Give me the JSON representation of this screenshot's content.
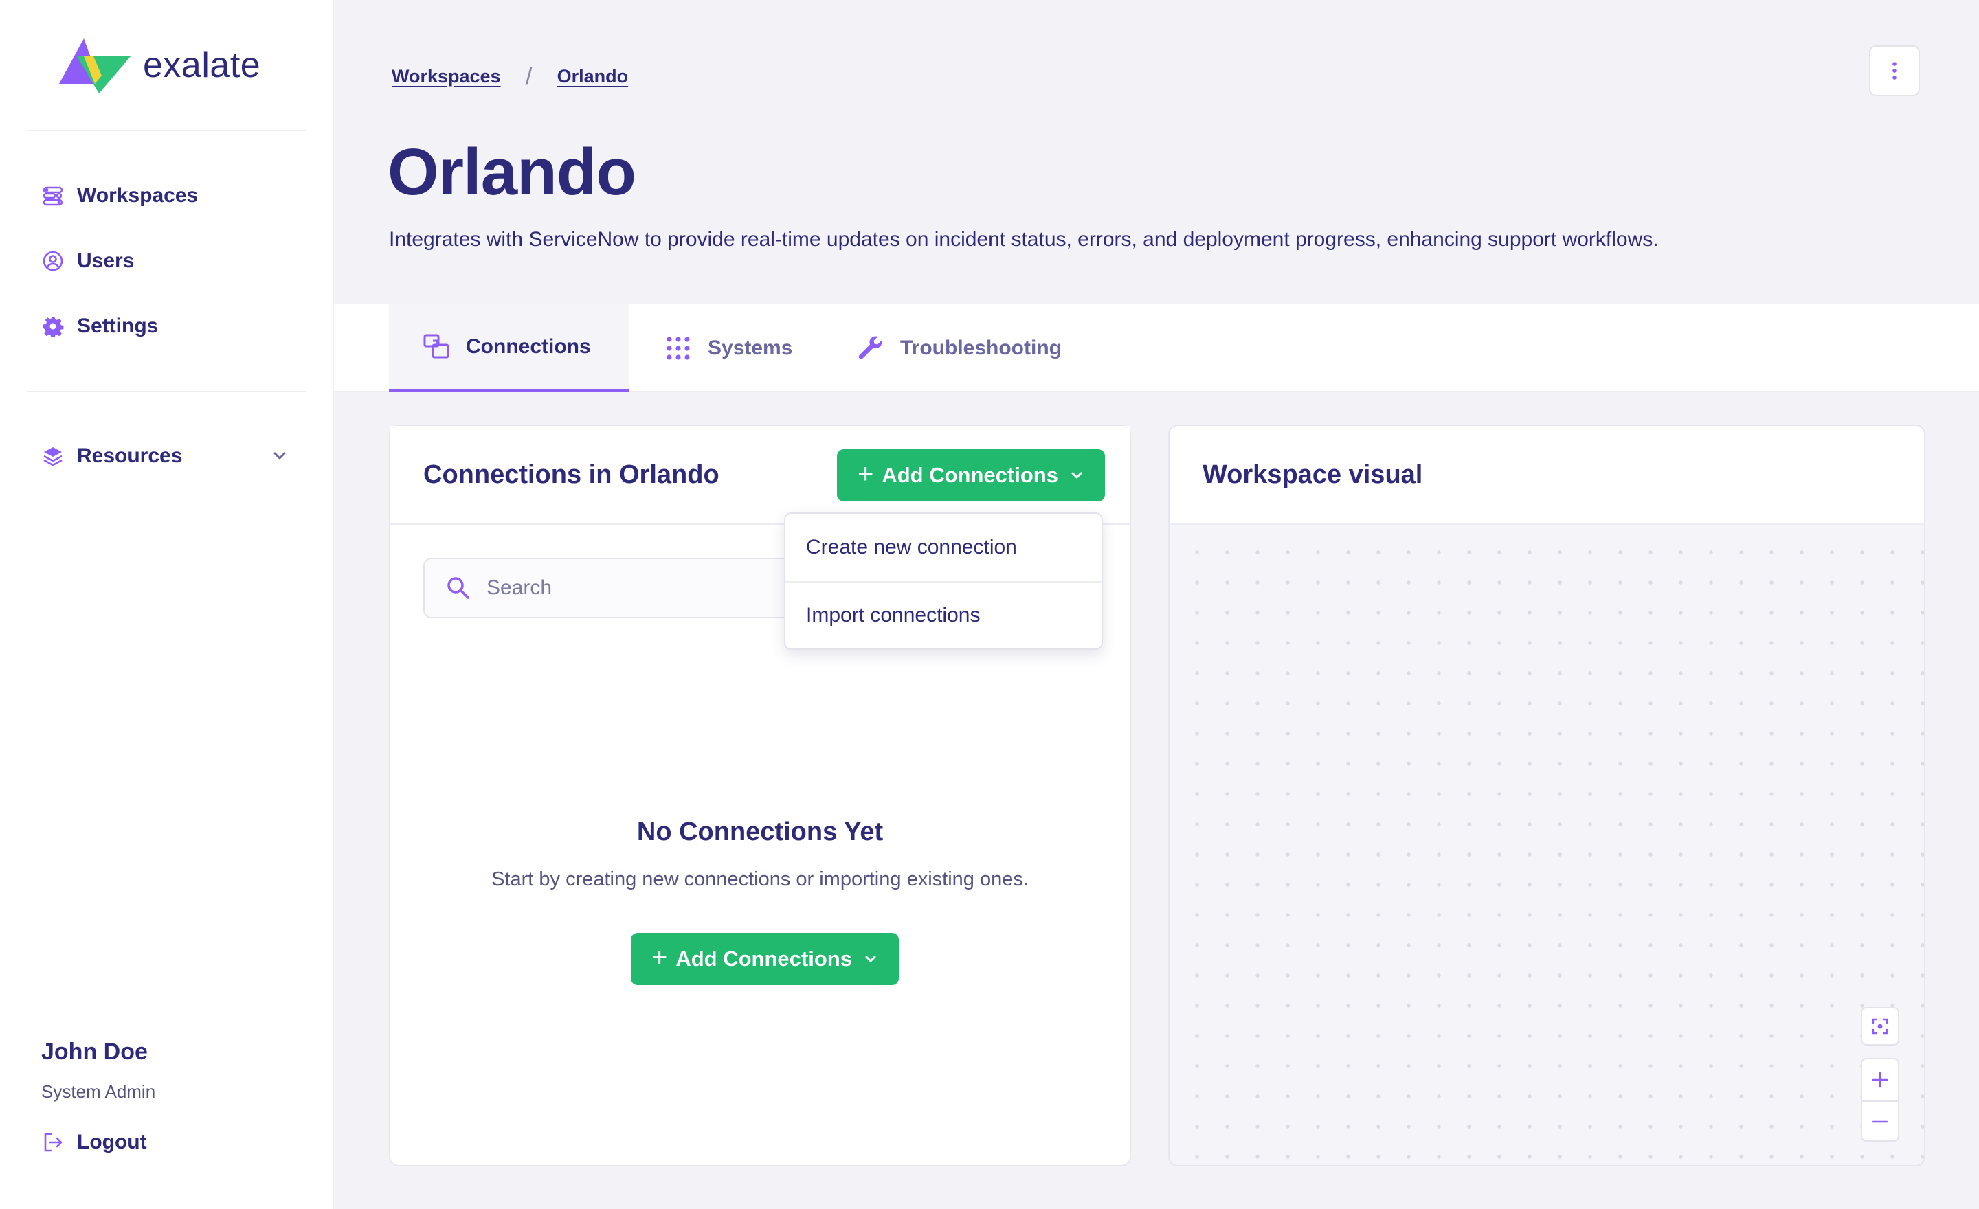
{
  "app": {
    "brand": "exalate",
    "accent": "#8e5cf7",
    "green": "#20b96d",
    "ink": "#2d2a7a"
  },
  "sidebar": {
    "items": [
      {
        "label": "Workspaces",
        "icon": "workspaces-icon"
      },
      {
        "label": "Users",
        "icon": "user-circle-icon"
      },
      {
        "label": "Settings",
        "icon": "gear-icon"
      },
      {
        "label": "Resources",
        "icon": "layers-icon"
      }
    ],
    "user": {
      "name": "John Doe",
      "role": "System Admin"
    },
    "logout": "Logout"
  },
  "breadcrumb": [
    "Workspaces",
    "Orlando"
  ],
  "page": {
    "title": "Orlando",
    "description": "Integrates with ServiceNow to provide real-time updates on incident status, errors, and deployment progress, enhancing support workflows."
  },
  "tabs": [
    {
      "label": "Connections",
      "icon": "connections-icon",
      "active": true
    },
    {
      "label": "Systems",
      "icon": "grid-dots-icon",
      "active": false
    },
    {
      "label": "Troubleshooting",
      "icon": "wrench-icon",
      "active": false
    }
  ],
  "connections": {
    "title": "Connections in Orlando",
    "add_button": "Add Connections",
    "search_placeholder": "Search",
    "dropdown": [
      "Create new connection",
      "Import connections"
    ],
    "empty_title": "No Connections Yet",
    "empty_sub": "Start by creating new connections or importing existing ones."
  },
  "visual": {
    "title": "Workspace visual"
  }
}
